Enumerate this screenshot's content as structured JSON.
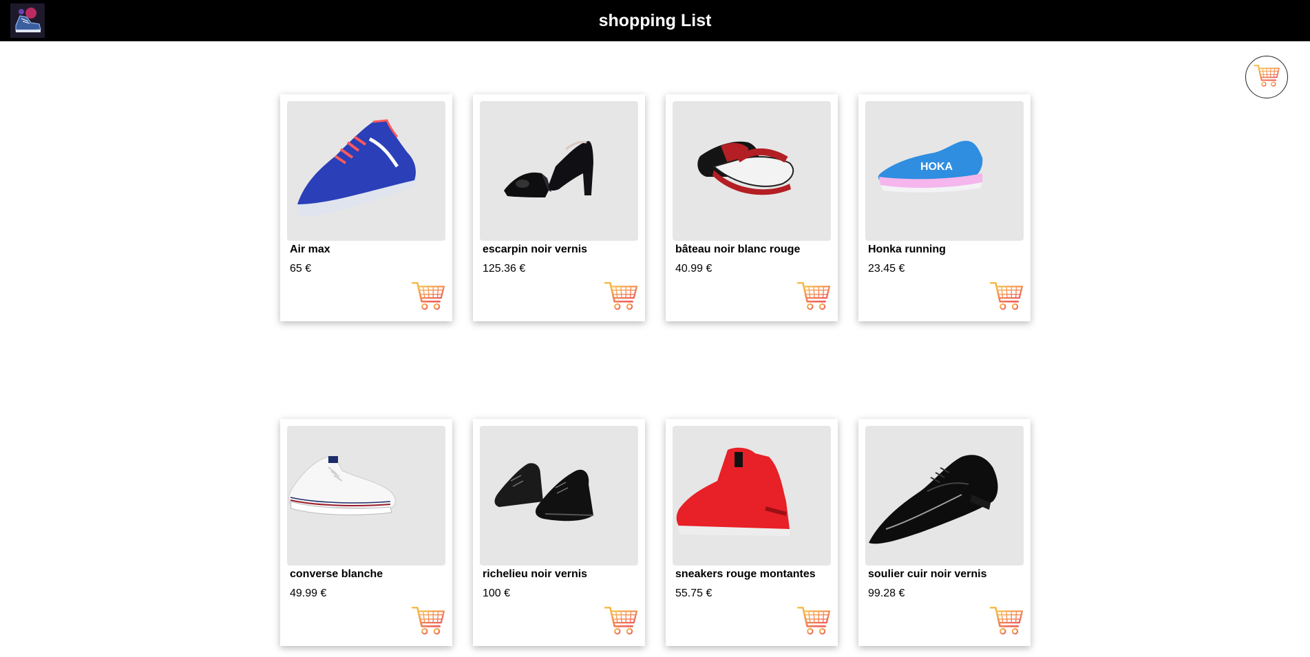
{
  "header": {
    "title": "shopping List",
    "logo_icon": "sneaker-logo-icon"
  },
  "cart": {
    "icon": "shopping-cart-icon",
    "accent_color": "#f39a3d"
  },
  "products": [
    {
      "name": "Air max",
      "price": "65 €",
      "image": "blue-running-shoe"
    },
    {
      "name": "escarpin noir vernis",
      "price": "125.36 €",
      "image": "black-patent-pumps"
    },
    {
      "name": "bâteau noir blanc rouge",
      "price": "40.99 €",
      "image": "boat-shoes-black-white-red"
    },
    {
      "name": "Honka running",
      "price": "23.45 €",
      "image": "hoka-running-shoe"
    },
    {
      "name": "converse blanche",
      "price": "49.99 €",
      "image": "white-converse"
    },
    {
      "name": "richelieu noir vernis",
      "price": "100 €",
      "image": "black-patent-oxfords"
    },
    {
      "name": "sneakers rouge montantes",
      "price": "55.75 €",
      "image": "red-high-top-sneakers"
    },
    {
      "name": "soulier cuir noir vernis",
      "price": "99.28 €",
      "image": "black-leather-dress-shoe"
    }
  ]
}
